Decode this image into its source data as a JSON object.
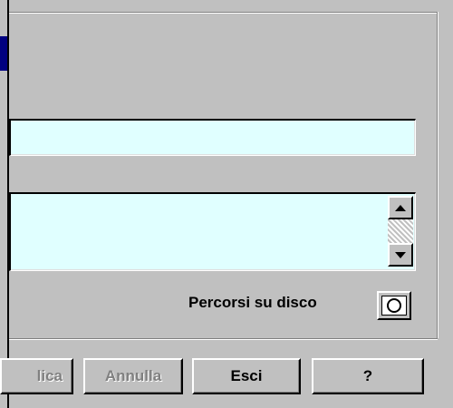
{
  "fields": {
    "field1_value": "",
    "field2_value": ""
  },
  "disk_paths": {
    "label": "Percorsi su disco",
    "icon": "disk-circle-icon"
  },
  "buttons": {
    "applica_label": "lica",
    "annulla_label": "Annulla",
    "esci_label": "Esci",
    "help_label": "?"
  },
  "colors": {
    "field_bg": "#e0ffff",
    "title_bar": "#000080",
    "face": "#c0c0c0"
  }
}
